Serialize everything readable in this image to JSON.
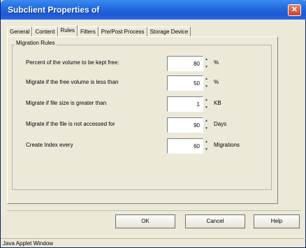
{
  "window": {
    "title": "Subclient Properties of",
    "close_glyph": "✕"
  },
  "tabs": [
    {
      "label": "General"
    },
    {
      "label": "Content"
    },
    {
      "label": "Rules",
      "active": true
    },
    {
      "label": "Filters"
    },
    {
      "label": "Pre/Post Process"
    },
    {
      "label": "Storage Device"
    }
  ],
  "group": {
    "label": "Migration Rules"
  },
  "rules": [
    {
      "label": "Percent of the volume to be kept free:",
      "value": "80",
      "unit": "%"
    },
    {
      "label": "Migrate if the free volume is less than",
      "value": "50",
      "unit": "%"
    },
    {
      "label": "Migrate if file size is greater than",
      "value": "1",
      "unit": "KB"
    },
    {
      "label": "Migrate if the file is not accessed for",
      "value": "90",
      "unit": "Days"
    },
    {
      "label": "Create Index every",
      "value": "60",
      "unit": "Migrations"
    }
  ],
  "buttons": {
    "ok": "OK",
    "cancel": "Cancel",
    "help": "Help"
  },
  "status": {
    "text": "Java Applet Window"
  },
  "icons": {
    "spin_up": "▲",
    "spin_down": "▼"
  },
  "colors": {
    "titlebar": "#2167de",
    "window_bg": "#ece9d8",
    "close_button": "#c9412c"
  }
}
